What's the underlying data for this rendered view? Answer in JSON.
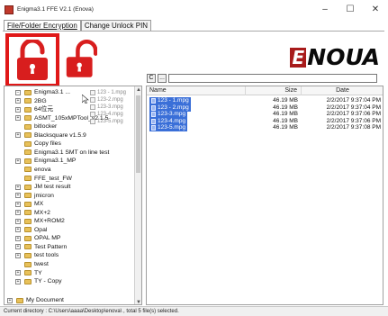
{
  "window": {
    "title": "Enigma3.1 FFE V2.1 (Enova)",
    "minimize": "–",
    "maximize": "☐",
    "close": "✕"
  },
  "tabs": [
    {
      "label": "File/Folder Encryption",
      "active": true
    },
    {
      "label": "Change Unlock PIN",
      "active": false
    }
  ],
  "toolbar": {
    "lock_button_icon": "unlock-icon",
    "unlock_button_icon": "unlock-icon",
    "lock_color": "#d81e1e"
  },
  "logo": {
    "text": "NOUA",
    "first_letter": "E",
    "accent": "#a81b1b"
  },
  "path_bar": {
    "button_c": "C",
    "button_dots": "...",
    "value": ""
  },
  "tree": {
    "items": [
      {
        "label": "Enigma3.1 ...",
        "expander": "−",
        "level": 1
      },
      {
        "label": "2BG",
        "expander": "+",
        "level": 1
      },
      {
        "label": "64位元",
        "expander": "+",
        "level": 1
      },
      {
        "label": "ASMT_105xMPTool_v2.1.5",
        "expander": "+",
        "level": 1
      },
      {
        "label": "bitlocker",
        "expander": "",
        "level": 1
      },
      {
        "label": "Blacksquare v1.5.9",
        "expander": "+",
        "level": 1
      },
      {
        "label": "Copy files",
        "expander": "",
        "level": 1
      },
      {
        "label": "Enigma3.1 SMT on line test",
        "expander": "",
        "level": 1
      },
      {
        "label": "Enigma3.1_MP",
        "expander": "+",
        "level": 1
      },
      {
        "label": "enova",
        "expander": "",
        "level": 1
      },
      {
        "label": "FFE_test_FW",
        "expander": "",
        "level": 1
      },
      {
        "label": "JM test result",
        "expander": "+",
        "level": 1
      },
      {
        "label": "jmicron",
        "expander": "+",
        "level": 1
      },
      {
        "label": "MX",
        "expander": "+",
        "level": 1
      },
      {
        "label": "MX+2",
        "expander": "+",
        "level": 1
      },
      {
        "label": "MX+ROM2",
        "expander": "+",
        "level": 1
      },
      {
        "label": "Opal",
        "expander": "+",
        "level": 1
      },
      {
        "label": "OPAL MP",
        "expander": "+",
        "level": 1
      },
      {
        "label": "Test Pattern",
        "expander": "+",
        "level": 1
      },
      {
        "label": "test tools",
        "expander": "+",
        "level": 1
      },
      {
        "label": "twest",
        "expander": "",
        "level": 1
      },
      {
        "label": "TY",
        "expander": "+",
        "level": 1
      },
      {
        "label": "TY - Copy",
        "expander": "+",
        "level": 1
      },
      {
        "label": "My Document",
        "expander": "+",
        "level": 0
      }
    ],
    "drag_ghost": [
      "123 - 1.mpg",
      "123-2.mpg",
      "123-3.mpg",
      "123-4.mpg",
      "123-5.mpg"
    ]
  },
  "file_list": {
    "headers": {
      "name": "Name",
      "size": "Size",
      "date": "Date"
    },
    "rows": [
      {
        "name": "123 - 1.mpg",
        "size": "46.19 MB",
        "date": "2/2/2017 9:37:04 PM"
      },
      {
        "name": "123 - 2.mpg",
        "size": "46.19 MB",
        "date": "2/2/2017 9:37:04 PM"
      },
      {
        "name": "123-3.mpg",
        "size": "46.19 MB",
        "date": "2/2/2017 9:37:06 PM"
      },
      {
        "name": "123-4.mpg",
        "size": "46.19 MB",
        "date": "2/2/2017 9:37:06 PM"
      },
      {
        "name": "123-5.mpg",
        "size": "46.19 MB",
        "date": "2/2/2017 9:37:08 PM"
      }
    ],
    "selection_color": "#3a6fd8"
  },
  "status": {
    "text": "Current directory : C:\\Users\\aaaa\\Desktop\\enova\\ , total 5 file(s) selected."
  }
}
